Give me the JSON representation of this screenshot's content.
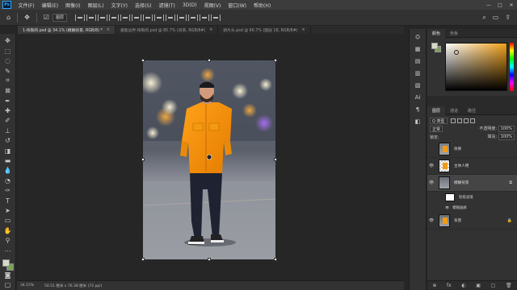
{
  "menubar": {
    "logo": "Ps",
    "items": [
      "文件(F)",
      "编辑(E)",
      "图像(I)",
      "图层(L)",
      "文字(Y)",
      "选择(S)",
      "滤镜(T)",
      "3D(D)",
      "视图(V)",
      "窗口(W)",
      "帮助(H)"
    ],
    "window_controls": [
      "—",
      "□",
      "✕"
    ]
  },
  "options": {
    "move_icon": "✥",
    "auto_select_label": "图层"
  },
  "tabs": [
    {
      "label": "1-快製的.psd @ 34.1% (模糊背景, RGB/8) *",
      "active": true
    },
    {
      "label": "基础边界-快製的.psd @ 85.7% (背景, RGB/8#)",
      "active": false
    },
    {
      "label": "新片头.psd @ 66.7% (图层 18, RGB/8#)",
      "active": false
    }
  ],
  "status": {
    "zoom": "34.15%",
    "info": "50.51 厘米 x 76.38 厘米 (72 ppi)"
  },
  "color_panel": {
    "tabs": [
      "颜色",
      "色板"
    ],
    "accent_color": "#f0a018"
  },
  "layers_panel": {
    "tabs": [
      "图层",
      "通道",
      "路径"
    ],
    "filter_label": "Q 类型",
    "blend_mode": "正常",
    "opacity_label": "不透明度:",
    "opacity_value": "100%",
    "lock_label": "锁定:",
    "fill_label": "填充:",
    "fill_value": "100%",
    "layers": [
      {
        "name": "效果",
        "visible": false,
        "selected": false
      },
      {
        "name": "主体人物",
        "visible": true,
        "selected": false
      },
      {
        "name": "模糊背景",
        "visible": true,
        "selected": true
      }
    ],
    "sublayers": [
      "智能滤镜",
      "模糊画廊"
    ],
    "background_layer": "背景",
    "bottom_icons": [
      "⊕",
      "fx",
      "◐",
      "▣",
      "▢",
      "🗑"
    ]
  },
  "strip_icons": [
    "⛭",
    "▦",
    "▤",
    "▥",
    "▧",
    "Ai",
    "¶",
    "◧"
  ]
}
